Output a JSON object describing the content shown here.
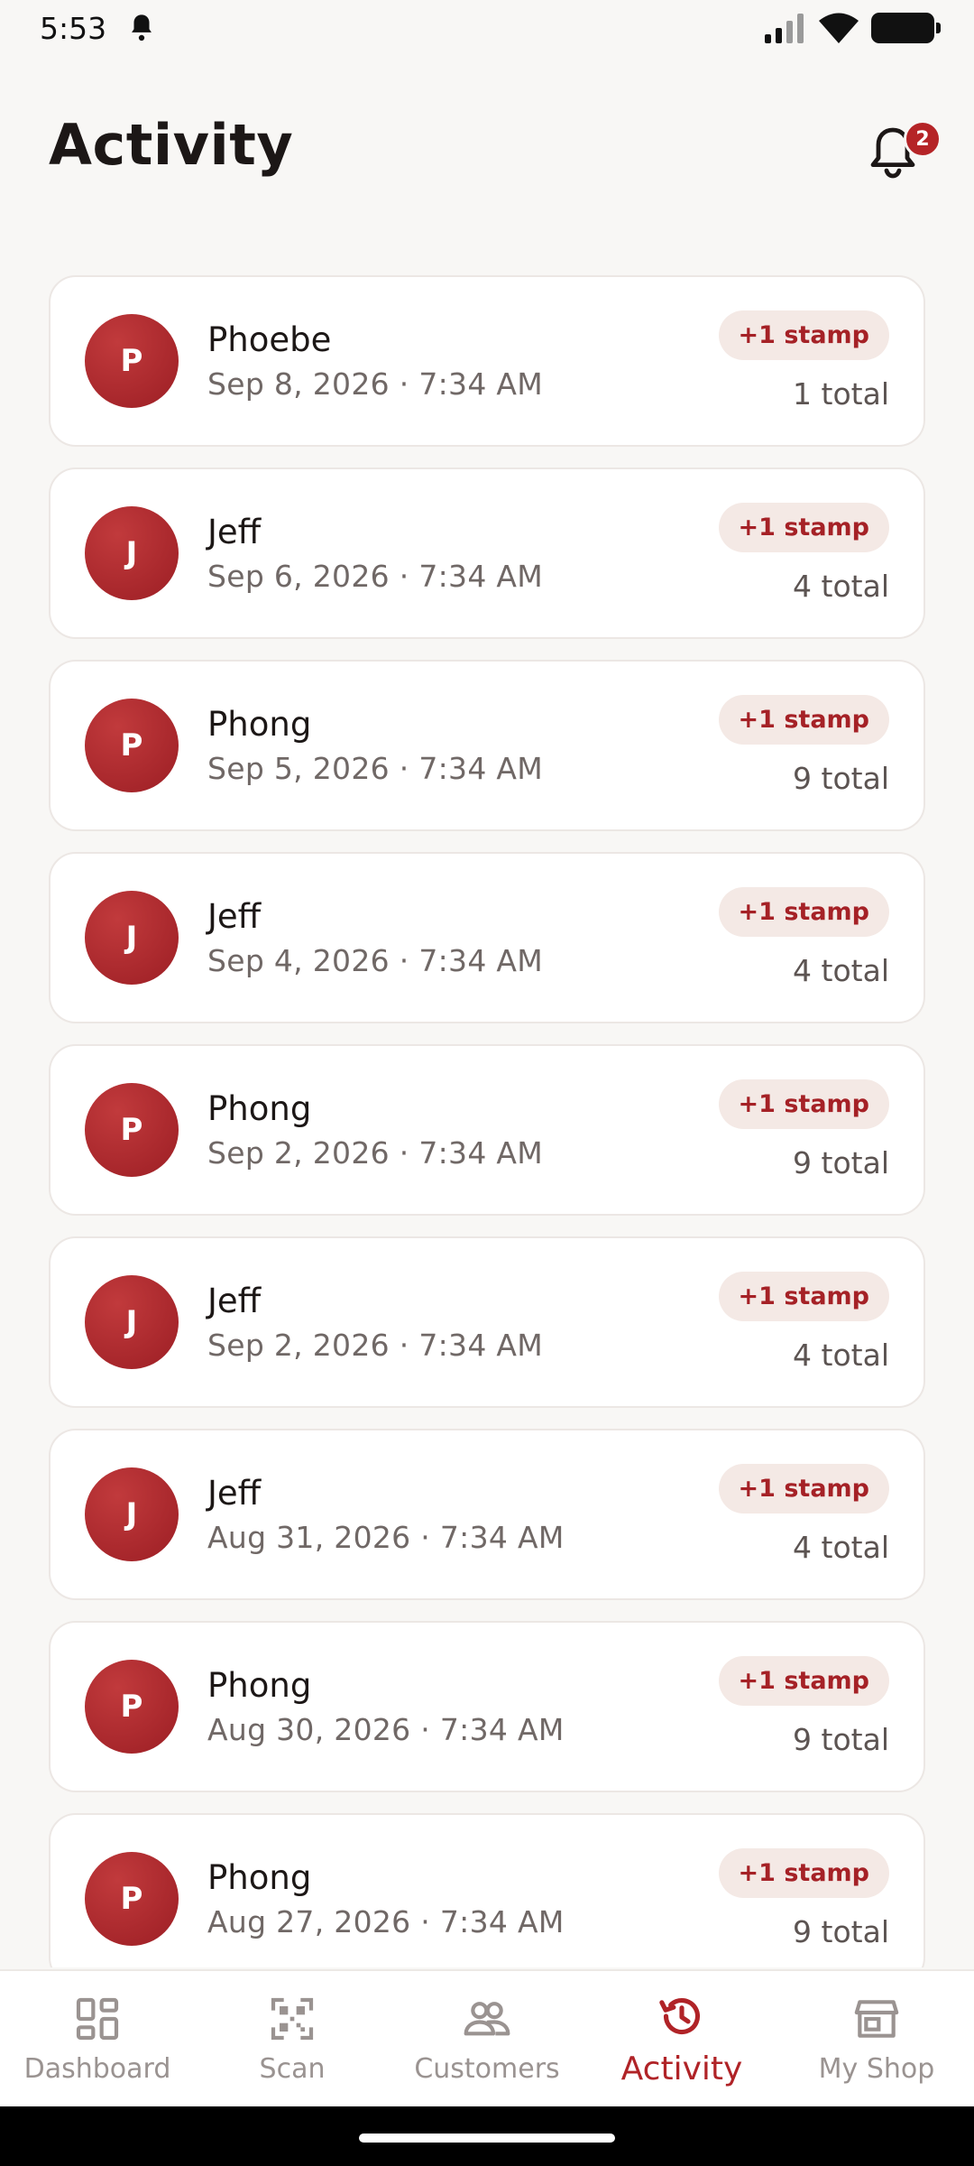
{
  "status_bar": {
    "time": "5:53"
  },
  "header": {
    "title": "Activity",
    "notification_count": "2"
  },
  "activity": [
    {
      "initial": "P",
      "name": "Phoebe",
      "date": "Sep 8, 2026 · 7:34 AM",
      "badge": "+1 stamp",
      "total": "1 total"
    },
    {
      "initial": "J",
      "name": "Jeff",
      "date": "Sep 6, 2026 · 7:34 AM",
      "badge": "+1 stamp",
      "total": "4 total"
    },
    {
      "initial": "P",
      "name": "Phong",
      "date": "Sep 5, 2026 · 7:34 AM",
      "badge": "+1 stamp",
      "total": "9 total"
    },
    {
      "initial": "J",
      "name": "Jeff",
      "date": "Sep 4, 2026 · 7:34 AM",
      "badge": "+1 stamp",
      "total": "4 total"
    },
    {
      "initial": "P",
      "name": "Phong",
      "date": "Sep 2, 2026 · 7:34 AM",
      "badge": "+1 stamp",
      "total": "9 total"
    },
    {
      "initial": "J",
      "name": "Jeff",
      "date": "Sep 2, 2026 · 7:34 AM",
      "badge": "+1 stamp",
      "total": "4 total"
    },
    {
      "initial": "J",
      "name": "Jeff",
      "date": "Aug 31, 2026 · 7:34 AM",
      "badge": "+1 stamp",
      "total": "4 total"
    },
    {
      "initial": "P",
      "name": "Phong",
      "date": "Aug 30, 2026 · 7:34 AM",
      "badge": "+1 stamp",
      "total": "9 total"
    },
    {
      "initial": "P",
      "name": "Phong",
      "date": "Aug 27, 2026 · 7:34 AM",
      "badge": "+1 stamp",
      "total": "9 total"
    }
  ],
  "nav": {
    "items": [
      {
        "label": "Dashboard",
        "icon": "dashboard-icon"
      },
      {
        "label": "Scan",
        "icon": "qr-scan-icon"
      },
      {
        "label": "Customers",
        "icon": "customers-icon"
      },
      {
        "label": "Activity",
        "icon": "history-icon",
        "active": true
      },
      {
        "label": "My Shop",
        "icon": "store-icon"
      }
    ]
  },
  "colors": {
    "accent": "#b02327",
    "background": "#f8f7f5",
    "badge_bg": "#f4e9e5",
    "card_border": "#ece7e4"
  }
}
